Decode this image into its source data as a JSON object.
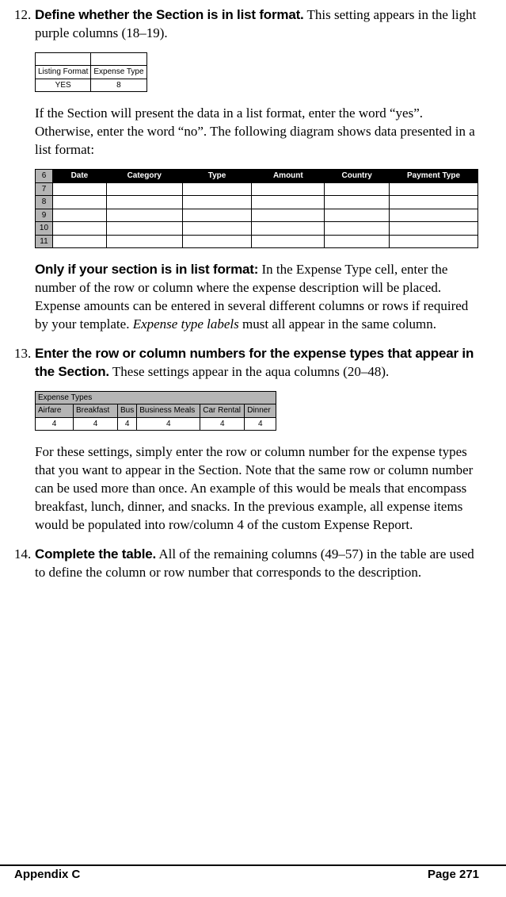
{
  "items": [
    {
      "num": "12.",
      "heading": "Define whether the Section is in list format.",
      "lead": " This setting appears in the light purple columns (18–19).",
      "tbl_listing": {
        "headers": [
          "Listing Format",
          "Expense Type"
        ],
        "row": [
          "YES",
          "8"
        ]
      },
      "para2_a": "If the Section will present the data in a list format, enter the word “yes”. Otherwise, enter the word “no”. The following diagram shows data presented in a list format:",
      "tbl_grid": {
        "headers": [
          "Date",
          "Category",
          "Type",
          "Amount",
          "Country",
          "Payment Type"
        ],
        "rownums": [
          "6",
          "7",
          "8",
          "9",
          "10",
          "11"
        ]
      },
      "para3_bold": "Only if your section is in list format:",
      "para3_rest": " In the Expense Type cell, enter the number of the row or column where the expense description will be placed. Expense amounts can be entered in several different columns or rows if required by your template. ",
      "para3_em": "Expense type labels",
      "para3_tail": " must all appear in the same column."
    },
    {
      "num": "13.",
      "heading": "Enter the row or column numbers for the expense types that appear in the Section.",
      "lead": " These settings appear in the aqua columns (20–48).",
      "tbl_etypes": {
        "title": "Expense Types",
        "headers": [
          "Airfare",
          "Breakfast",
          "Bus",
          "Business Meals",
          "Car Rental",
          "Dinner"
        ],
        "row": [
          "4",
          "4",
          "4",
          "4",
          "4",
          "4"
        ]
      },
      "para2": "For these settings, simply enter the row or column number for the expense types that you want to appear in the Section. Note that the same row or column number can be used more than once. An example of this would be meals that encompass breakfast, lunch, dinner, and snacks. In the previous example, all expense items would be populated into row/column 4 of the custom Expense Report."
    },
    {
      "num": "14.",
      "heading": "Complete the table.",
      "lead": " All of the remaining columns (49–57) in the table are used to define the column or row number that corresponds to the description."
    }
  ],
  "footer": {
    "left": "Appendix C",
    "right": "Page 271"
  }
}
